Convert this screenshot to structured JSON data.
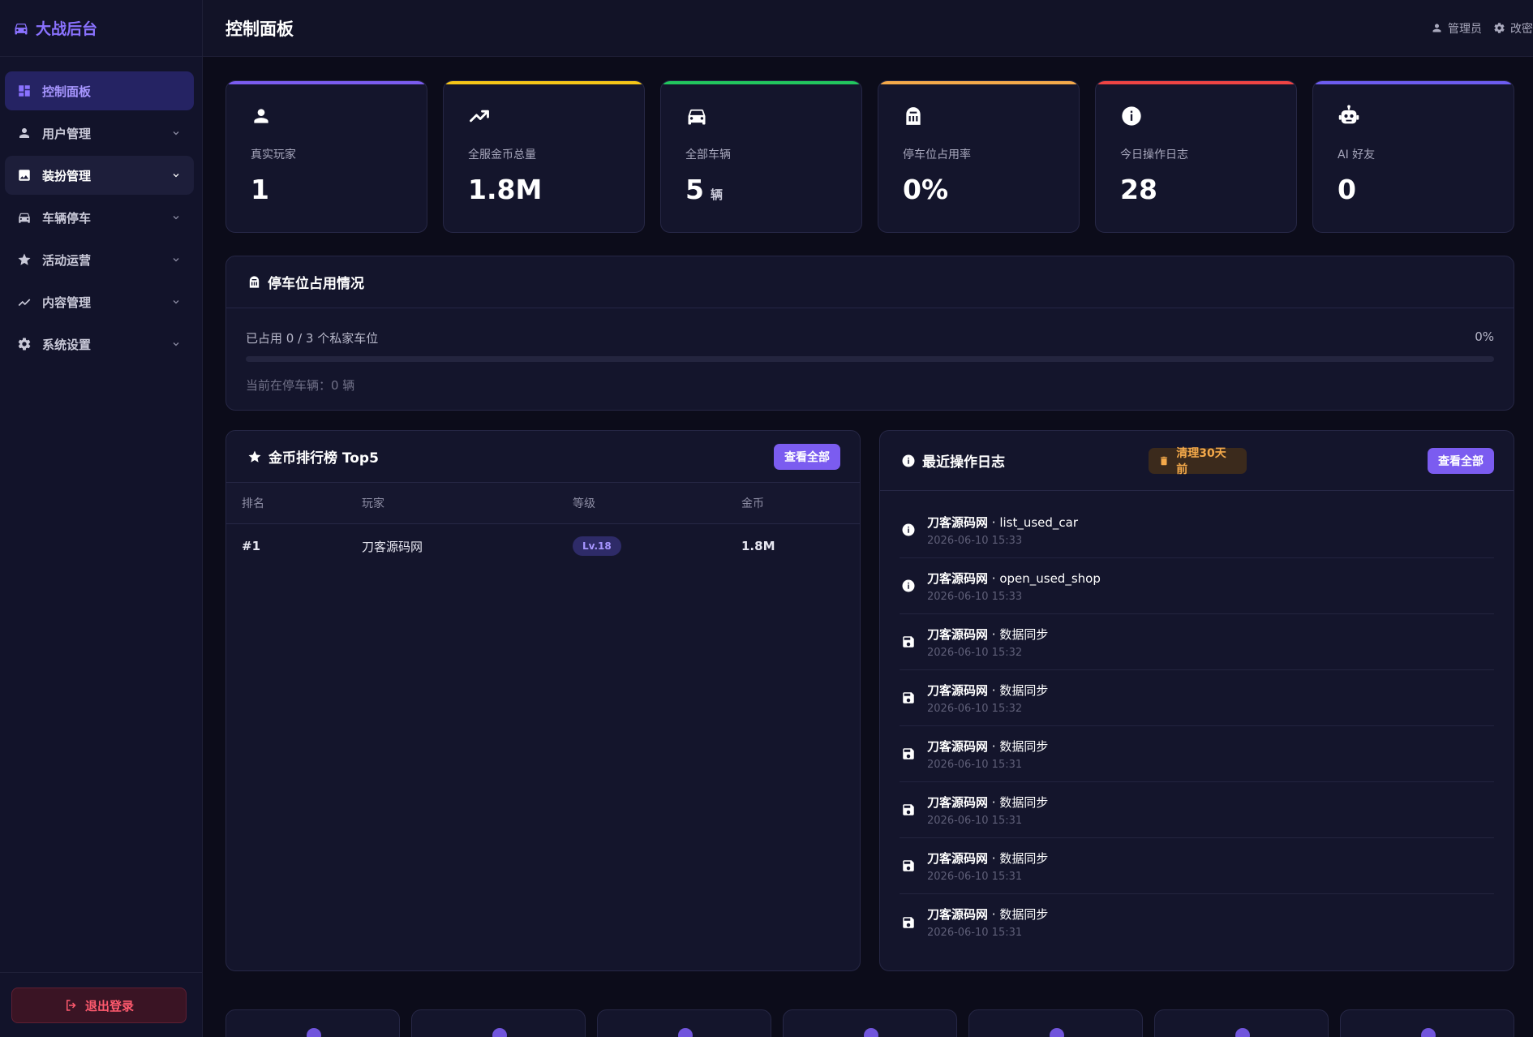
{
  "brand": {
    "title": "大战后台",
    "icon": "car-icon"
  },
  "sidebar": {
    "items": [
      {
        "label": "控制面板",
        "icon": "dashboard-icon",
        "state": "active"
      },
      {
        "label": "用户管理",
        "icon": "user-icon",
        "state": ""
      },
      {
        "label": "装扮管理",
        "icon": "image-icon",
        "state": "open"
      },
      {
        "label": "车辆停车",
        "icon": "car-icon",
        "state": ""
      },
      {
        "label": "活动运营",
        "icon": "star-icon",
        "state": ""
      },
      {
        "label": "内容管理",
        "icon": "chart-line-icon",
        "state": ""
      },
      {
        "label": "系统设置",
        "icon": "gear-icon",
        "state": ""
      }
    ],
    "logout_label": "退出登录"
  },
  "topbar": {
    "title": "控制面板",
    "admin_label": "管理员",
    "change_pw_label": "改密"
  },
  "stats": [
    {
      "label": "真实玩家",
      "value": "1",
      "unit": "",
      "icon": "user-icon",
      "color": "#7b5cf0"
    },
    {
      "label": "全服金币总量",
      "value": "1.8M",
      "unit": "",
      "icon": "trending-up-icon",
      "color": "#f5c518"
    },
    {
      "label": "全部车辆",
      "value": "5",
      "unit": "辆",
      "icon": "car-icon",
      "color": "#22c55e"
    },
    {
      "label": "停车位占用率",
      "value": "0%",
      "unit": "",
      "icon": "parking-icon",
      "color": "#f4a94a"
    },
    {
      "label": "今日操作日志",
      "value": "28",
      "unit": "",
      "icon": "info-icon",
      "color": "#ef4444"
    },
    {
      "label": "AI 好友",
      "value": "0",
      "unit": "",
      "icon": "robot-icon",
      "color": "#6d5cf0"
    }
  ],
  "parking": {
    "title": "停车位占用情况",
    "occupied_text": "已占用 0 / 3 个私家车位",
    "percent_text": "0%",
    "fill_fraction": 0,
    "sub_text": "当前在停车辆：0 辆"
  },
  "ranking": {
    "title": "金币排行榜 Top5",
    "view_all": "查看全部",
    "columns": [
      "排名",
      "玩家",
      "等级",
      "金币"
    ],
    "rows": [
      {
        "rank": "#1",
        "player": "刀客源码网",
        "level": "Lv.18",
        "coins": "1.8M"
      }
    ]
  },
  "logs": {
    "title": "最近操作日志",
    "clear_label": "清理30天前",
    "view_all": "查看全部",
    "items": [
      {
        "icon": "info-icon",
        "user": "刀客源码网",
        "action": " · list_used_car",
        "time": "2026-06-10 15:33"
      },
      {
        "icon": "info-icon",
        "user": "刀客源码网",
        "action": " · open_used_shop",
        "time": "2026-06-10 15:33"
      },
      {
        "icon": "save-icon",
        "user": "刀客源码网",
        "action": " · 数据同步",
        "time": "2026-06-10 15:32"
      },
      {
        "icon": "save-icon",
        "user": "刀客源码网",
        "action": " · 数据同步",
        "time": "2026-06-10 15:32"
      },
      {
        "icon": "save-icon",
        "user": "刀客源码网",
        "action": " · 数据同步",
        "time": "2026-06-10 15:31"
      },
      {
        "icon": "save-icon",
        "user": "刀客源码网",
        "action": " · 数据同步",
        "time": "2026-06-10 15:31"
      },
      {
        "icon": "save-icon",
        "user": "刀客源码网",
        "action": " · 数据同步",
        "time": "2026-06-10 15:31"
      },
      {
        "icon": "save-icon",
        "user": "刀客源码网",
        "action": " · 数据同步",
        "time": "2026-06-10 15:31"
      }
    ]
  }
}
